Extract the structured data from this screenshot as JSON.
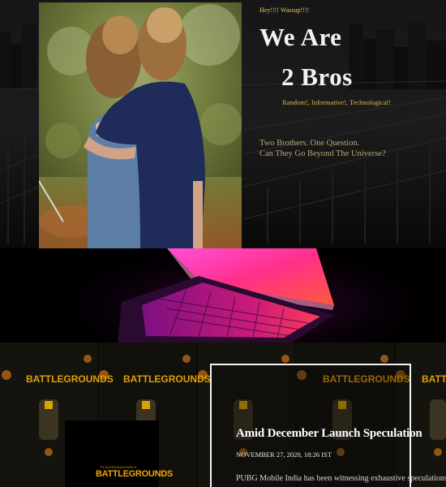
{
  "hero": {
    "greeting": "Hey!!!! Wassup!!!!",
    "title_line1": "We Are",
    "title_line2": "2 Bros",
    "tagline": "Random!, Informative!, Technological!",
    "description_line1": "Two Brothers. One Question.",
    "description_line2": "Can They Go Beyond The Universe?"
  },
  "pubg_logo": {
    "sub": "PLAYERUNKNOWN'S",
    "main": "BATTLEGROUNDS"
  },
  "article": {
    "title": "Amid December Launch Speculation",
    "date": "NOVEMBER 27, 2020, 18:26 IST",
    "excerpt": "PUBG Mobile India has been witnessing exhaustive speculations"
  },
  "colors": {
    "accent_gold": "#e2b34a",
    "laptop_magenta": "#ff2f8a",
    "card_border": "#f2f2f2"
  }
}
